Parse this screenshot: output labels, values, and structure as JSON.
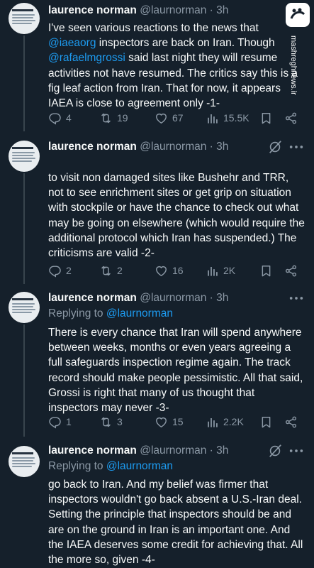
{
  "watermark": {
    "site": "mashreghnews.ir"
  },
  "tweets": [
    {
      "name": "laurence norman",
      "meta": "@laurnorman · 3h",
      "reply_to_prefix": "",
      "reply_to_handle": "",
      "text_parts": [
        "I've seen various reactions to the news that ",
        "@iaeaorg",
        " inspectors are back on Iran. Though ",
        "@rafaelmgrossi",
        " said last night they will resume activities not have resumed. The critics say this is a fig leaf action from Iran. That for now, it appears IAEA is close to agreement only -1-"
      ],
      "replies": "4",
      "reposts": "19",
      "likes": "67",
      "views": "15.5K"
    },
    {
      "name": "laurence norman",
      "meta": "@laurnorman · 3h",
      "text": "to visit non damaged sites like Bushehr and TRR, not to see enrichment sites or get grip on situation with stockpile or have the chance to check out what may be going on elsewhere (which would require the additional protocol which Iran has suspended.) The criticisms are valid -2-",
      "replies": "2",
      "reposts": "2",
      "likes": "16",
      "views": "2K"
    },
    {
      "name": "laurence norman",
      "meta": "@laurnorman · 3h",
      "reply_to_prefix": "Replying to ",
      "reply_to_handle": "@laurnorman",
      "text": "There is every chance that Iran will spend anywhere between weeks, months or even years agreeing a full safeguards inspection regime again. The track record should make people pessimistic. All that said, Grossi is right that many of us thought that inspectors may never -3-",
      "replies": "1",
      "reposts": "3",
      "likes": "15",
      "views": "2.2K"
    },
    {
      "name": "laurence norman",
      "meta": "@laurnorman · 3h",
      "reply_to_prefix": "Replying to ",
      "reply_to_handle": "@laurnorman",
      "text": "go back to Iran. And my belief was firmer that inspectors wouldn't go back absent a U.S.-Iran deal. Setting the principle that inspectors should be and are on the ground in Iran is an important one. And the IAEA deserves some credit for achieving that. All the more so, given -4-"
    }
  ],
  "colors": {
    "background": "#15202b",
    "text": "#f7f9f9",
    "muted": "#8b98a5",
    "link": "#1d9bf0",
    "divider": "#38444d"
  },
  "icons": [
    "reply-icon",
    "repost-icon",
    "like-icon",
    "views-icon",
    "bookmark-icon",
    "share-icon",
    "grok-icon",
    "more-icon"
  ]
}
